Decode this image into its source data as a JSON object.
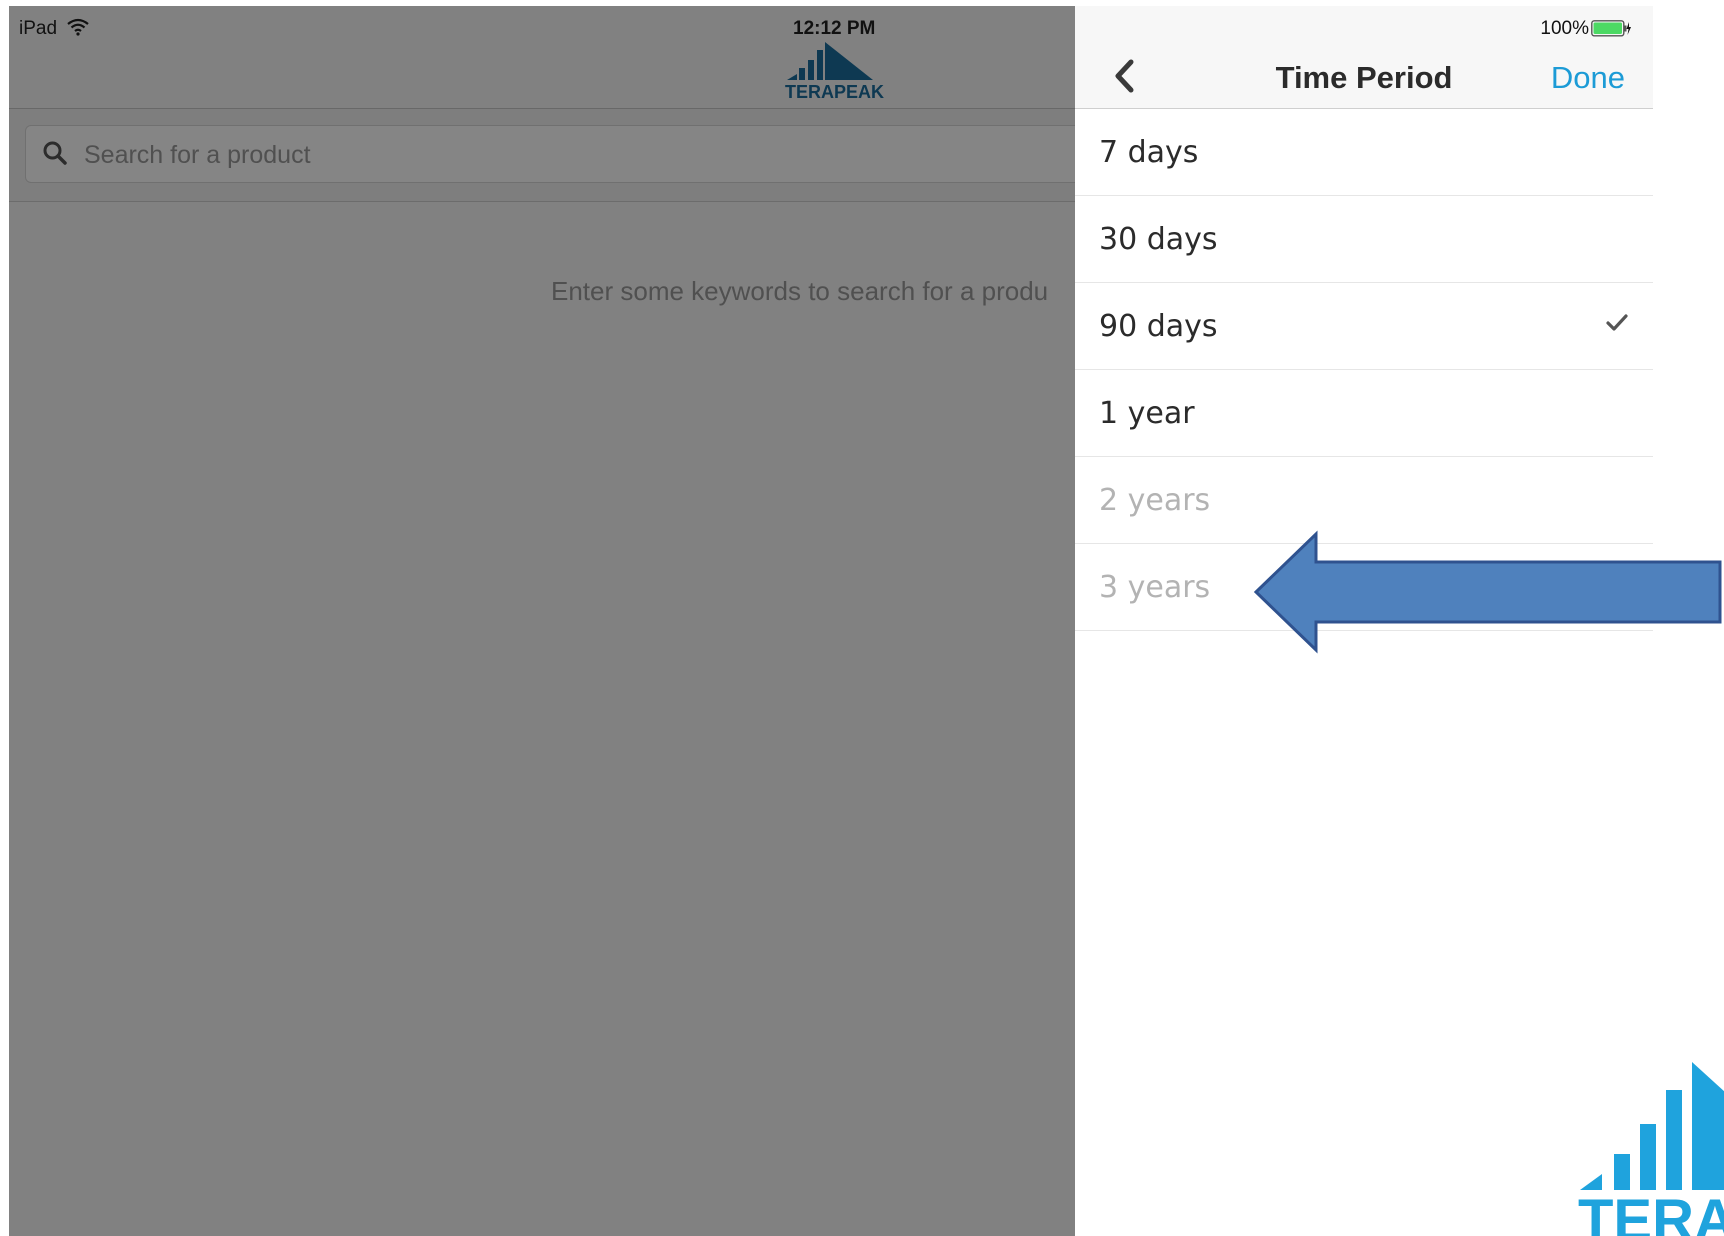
{
  "status_bar": {
    "carrier": "iPad",
    "time": "12:12 PM",
    "battery": "100%"
  },
  "left_app": {
    "logo_text": "TERAPEAK",
    "search": {
      "placeholder": "Search for a product",
      "value": ""
    },
    "empty_hint": "Enter some keywords to search for a produ"
  },
  "panel": {
    "title": "Time Period",
    "done_label": "Done",
    "items": [
      {
        "label": "7 days",
        "selected": false,
        "enabled": true
      },
      {
        "label": "30 days",
        "selected": false,
        "enabled": true
      },
      {
        "label": "90 days",
        "selected": true,
        "enabled": true
      },
      {
        "label": "1 year",
        "selected": false,
        "enabled": true
      },
      {
        "label": "2 years",
        "selected": false,
        "enabled": false
      },
      {
        "label": "3 years",
        "selected": false,
        "enabled": false
      }
    ]
  },
  "colors": {
    "accent": "#1c9bd6",
    "arrow_fill": "#4f81bd",
    "arrow_stroke": "#2f528f",
    "logo_blue": "#1fa3dd",
    "brand_dark": "#1b6d9e"
  },
  "icons": {
    "back": "chevron-left-icon",
    "search": "search-icon",
    "check": "checkmark-icon",
    "wifi": "wifi-icon",
    "battery": "battery-icon"
  }
}
